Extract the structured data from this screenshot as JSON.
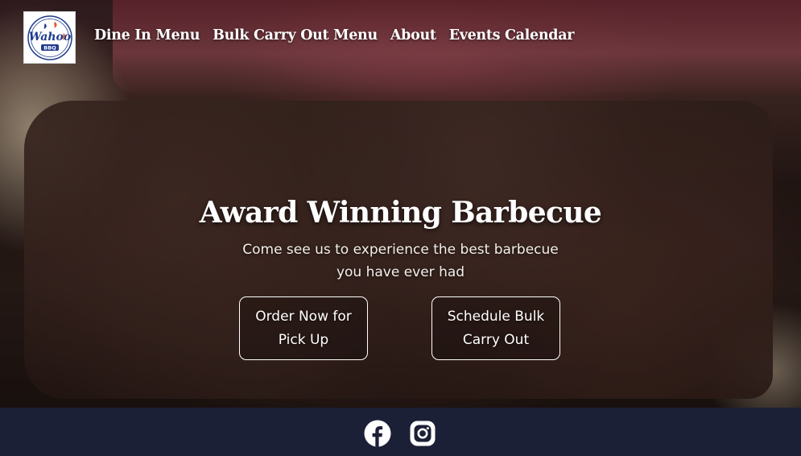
{
  "brand": {
    "logo_text": "Wahoo",
    "logo_subtext": "BBQ"
  },
  "nav": {
    "items": [
      {
        "label": "Dine In Menu"
      },
      {
        "label": "Bulk Carry Out Menu"
      },
      {
        "label": "About"
      },
      {
        "label": "Events Calendar"
      }
    ]
  },
  "hero": {
    "title": "Award Winning Barbecue",
    "subtitle": "Come see us to experience the best barbecue you have ever had",
    "buttons": [
      {
        "label": "Order Now for Pick Up"
      },
      {
        "label": "Schedule Bulk Carry Out"
      }
    ]
  },
  "footer": {
    "social": [
      {
        "icon": "facebook-icon"
      },
      {
        "icon": "instagram-icon"
      }
    ]
  },
  "colors": {
    "footer_bg": "#1c2036",
    "text": "#ffffff",
    "logo_blue": "#1f3b8f",
    "logo_accent": "#e0562a"
  }
}
